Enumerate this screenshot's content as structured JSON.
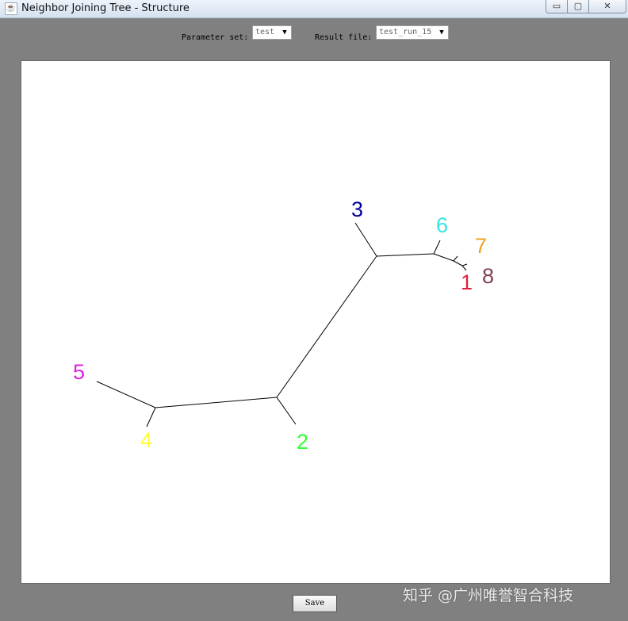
{
  "window": {
    "title": "Neighbor Joining Tree - Structure",
    "controls": {
      "minimize": "▭",
      "maximize": "▢",
      "close": "✕"
    }
  },
  "toolbar": {
    "parameter_label": "Parameter set:",
    "parameter_value": "test",
    "result_label": "Result file:",
    "result_value": "test_run_15"
  },
  "tree": {
    "leaves": [
      {
        "label": "1",
        "color": "#e01f3d"
      },
      {
        "label": "2",
        "color": "#33ff33"
      },
      {
        "label": "3",
        "color": "#000099"
      },
      {
        "label": "4",
        "color": "#ffff33"
      },
      {
        "label": "5",
        "color": "#e020e0"
      },
      {
        "label": "6",
        "color": "#33e5e5"
      },
      {
        "label": "7",
        "color": "#f0a020"
      },
      {
        "label": "8",
        "color": "#804050"
      }
    ]
  },
  "save_label": "Save",
  "watermark": "知乎 @广州唯誉智合科技"
}
